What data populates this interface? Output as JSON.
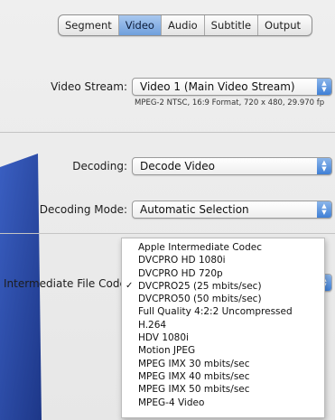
{
  "tabs": [
    {
      "label": "Segment",
      "selected": false
    },
    {
      "label": "Video",
      "selected": true
    },
    {
      "label": "Audio",
      "selected": false
    },
    {
      "label": "Subtitle",
      "selected": false
    },
    {
      "label": "Output",
      "selected": false
    }
  ],
  "video_stream": {
    "label": "Video Stream:",
    "value": "Video 1 (Main Video Stream)",
    "info": "MPEG-2 NTSC, 16:9 Format, 720 x 480, 29.970 fp"
  },
  "decoding": {
    "label": "Decoding:",
    "value": "Decode Video"
  },
  "decoding_mode": {
    "label": "Decoding Mode:",
    "value": "Automatic Selection"
  },
  "intermediate_codec": {
    "label": "Intermediate File Codec",
    "options": [
      {
        "label": "Apple Intermediate Codec",
        "checked": false
      },
      {
        "label": "DVCPRO HD 1080i",
        "checked": false
      },
      {
        "label": "DVCPRO HD 720p",
        "checked": false
      },
      {
        "label": "DVCPRO25 (25 mbits/sec)",
        "checked": true
      },
      {
        "label": "DVCPRO50 (50 mbits/sec)",
        "checked": false
      },
      {
        "label": "Full Quality 4:2:2 Uncompressed",
        "checked": false
      },
      {
        "label": "H.264",
        "checked": false
      },
      {
        "label": "HDV 1080i",
        "checked": false
      },
      {
        "label": "Motion JPEG",
        "checked": false
      },
      {
        "label": "MPEG IMX 30 mbits/sec",
        "checked": false
      },
      {
        "label": "MPEG IMX 40 mbits/sec",
        "checked": false
      },
      {
        "label": "MPEG IMX 50 mbits/sec",
        "checked": false
      },
      {
        "label": "MPEG-4 Video",
        "checked": false
      }
    ],
    "check_glyph": "✓"
  },
  "icons": {
    "popup_arrows": "updown-arrows-icon",
    "check": "checkmark-icon"
  },
  "colors": {
    "selected_tab": "#7fa9e2",
    "popup_arrow": "#3f7fd6",
    "backdrop_blue": "#2c4fa8"
  }
}
